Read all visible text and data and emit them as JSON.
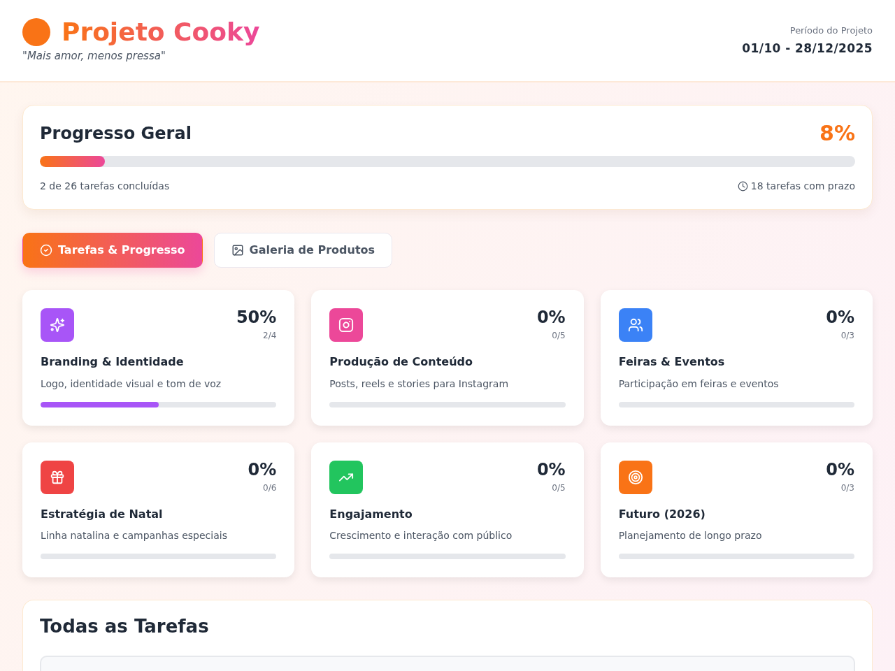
{
  "header": {
    "title": "Projeto Cooky",
    "tagline": "\"Mais amor, menos pressa\"",
    "period_label": "Período do Projeto",
    "period": "01/10 - 28/12/2025"
  },
  "overall": {
    "title": "Progresso Geral",
    "percent": "8%",
    "level": 0.08,
    "completed": "2 de 26 tarefas concluídas",
    "deadline": "18 tarefas com prazo"
  },
  "tabs": [
    {
      "kind": "tasks",
      "label": "Tarefas & Progresso",
      "selected": true
    },
    {
      "kind": "gallery",
      "label": "Galeria de Produtos",
      "selected": false
    }
  ],
  "categories": [
    {
      "kind": "branding",
      "color": "#a855f7",
      "percent": "50%",
      "count": "2/4",
      "title": "Branding & Identidade",
      "description": "Logo, identidade visual e tom de voz",
      "level": 0.5
    },
    {
      "kind": "content",
      "color": "#ec4899",
      "percent": "0%",
      "count": "0/5",
      "title": "Produção de Conteúdo",
      "description": "Posts, reels e stories para Instagram",
      "level": 0
    },
    {
      "kind": "events",
      "color": "#3b82f6",
      "percent": "0%",
      "count": "0/3",
      "title": "Feiras & Eventos",
      "description": "Participação em feiras e eventos",
      "level": 0
    },
    {
      "kind": "christmas",
      "color": "#ef4444",
      "percent": "0%",
      "count": "0/6",
      "title": "Estratégia de Natal",
      "description": "Linha natalina e campanhas especiais",
      "level": 0
    },
    {
      "kind": "engagement",
      "color": "#22c55e",
      "percent": "0%",
      "count": "0/5",
      "title": "Engajamento",
      "description": "Crescimento e interação com público",
      "level": 0
    },
    {
      "kind": "future",
      "color": "#f97316",
      "percent": "0%",
      "count": "0/3",
      "title": "Futuro (2026)",
      "description": "Planejamento de longo prazo",
      "level": 0
    }
  ],
  "all_tasks": {
    "title": "Todas as Tarefas"
  }
}
